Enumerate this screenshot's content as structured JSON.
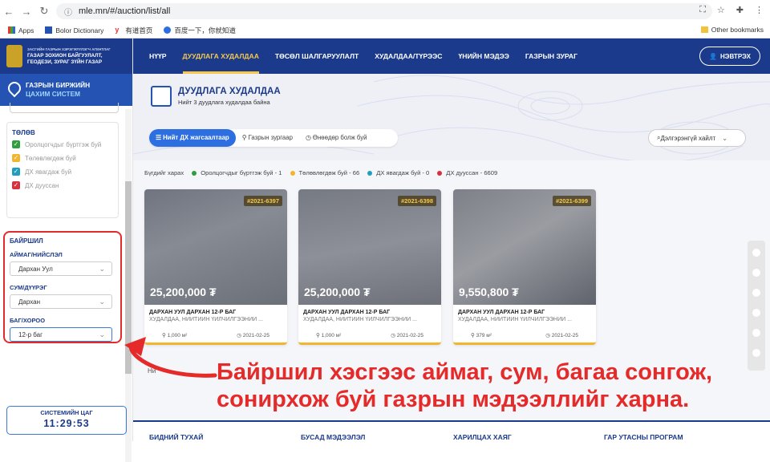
{
  "browser": {
    "url": "mle.mn/#/auction/list/all"
  },
  "bookmarks": [
    "Apps",
    "Bolor Dictionary",
    "有道首页",
    "百度一下，你就知道"
  ],
  "bookmarks_other": "Other bookmarks",
  "logo": {
    "line1": "ЗАСГИЙН ГАЗРЫН ХЭРЭГЖҮҮЛЭГЧ АГЕНТЛАГ",
    "line2": "ГАЗАР ЗОХИОН БАЙГУУЛАЛТ,",
    "line3": "ГЕОДЕЗИ, ЗУРАГ ЗҮЙН ГАЗАР"
  },
  "system": {
    "line1": "ГАЗРЫН БИРЖИЙН",
    "line2": "ЦАХИМ СИСТЕМ"
  },
  "status": {
    "title": "ТӨЛӨВ",
    "items": [
      {
        "label": "Оролцогчдыг бүртгэж буй",
        "color": "#2e9e3e"
      },
      {
        "label": "Төлөвлөгдөж буй",
        "color": "#f2b52e"
      },
      {
        "label": "ДХ явагдаж буй",
        "color": "#1f9ec0"
      },
      {
        "label": "ДХ дууссан",
        "color": "#d8303f"
      }
    ]
  },
  "location": {
    "title": "БАЙРШИЛ",
    "aimag_label": "АЙМАГ/НИЙСЛЭЛ",
    "aimag": "Дархан Уул",
    "sum_label": "СУМ/ДҮҮРЭГ",
    "sum": "Дархан",
    "bag_label": "БАГ/ХОРОО",
    "bag": "12-р баг"
  },
  "clock": {
    "label": "СИСТЕМИЙН ЦАГ",
    "time": "11:29:53"
  },
  "nav": [
    "НҮҮР",
    "ДУУДЛАГА ХУДАЛДАА",
    "ТӨСӨЛ ШАЛГАРУУЛАЛТ",
    "ХУДАЛДАА/ТҮРЭЭС",
    "ҮНИЙН МЭДЭЭ",
    "ГАЗРЫН ЗУРАГ"
  ],
  "login": "НЭВТРЭХ",
  "page": {
    "title": "ДУУДЛАГА ХУДАЛДАА",
    "subtitle": "Нийт 3 дуудлага худалдаа байна"
  },
  "tabs": [
    "Нийт ДХ жагсаалтаар",
    "Газрын зургаар",
    "Өнөөдөр болж буй"
  ],
  "advanced": "Дэлгэрэнгүй хайлт",
  "legend": [
    {
      "label": "Бүгдийг харах",
      "color": ""
    },
    {
      "label": "Оролцогчдыг бүртгэж буй - 1",
      "color": "#2e9e3e"
    },
    {
      "label": "Төлөвлөгдөж буй - 66",
      "color": "#f2b52e"
    },
    {
      "label": "ДХ явагдаж буй - 0",
      "color": "#1f9ec0"
    },
    {
      "label": "ДХ дууссан - 6609",
      "color": "#d8303f"
    }
  ],
  "cards": [
    {
      "id": "#2021-6397",
      "price": "25,200,000 ₮",
      "title": "ДАРХАН УУЛ ДАРХАН 12-Р БАГ",
      "sub": "ХУДАЛДАА, НИЙТИЙН ҮЙЛЧИЛГЭЭНИЙ ...",
      "area": "1,000 м²",
      "date": "2021-02-25"
    },
    {
      "id": "#2021-6398",
      "price": "25,200,000 ₮",
      "title": "ДАРХАН УУЛ ДАРХАН 12-Р БАГ",
      "sub": "ХУДАЛДАА, НИЙТИЙН ҮЙЛЧИЛГЭЭНИЙ ...",
      "area": "1,000 м²",
      "date": "2021-02-25"
    },
    {
      "id": "#2021-6399",
      "price": "9,550,800 ₮",
      "title": "ДАРХАН УУЛ ДАРХАН 12-Р БАГ",
      "sub": "ХУДАЛДАА, НИЙТИЙН ҮЙЛЧИЛГЭЭНИЙ ...",
      "area": "379 м²",
      "date": "2021-02-25"
    }
  ],
  "pager": "Ни",
  "footer": [
    "БИДНИЙ ТУХАЙ",
    "БУСАД МЭДЭЭЛЭЛ",
    "ХАРИЛЦАХ ХАЯГ",
    "ГАР УТАСНЫ ПРОГРАМ"
  ],
  "annotation": {
    "line1": "Байршил хэсгээс аймаг, сум, багаа сонгож,",
    "line2": "сонирхож буй газрын мэдээллийг харна."
  }
}
